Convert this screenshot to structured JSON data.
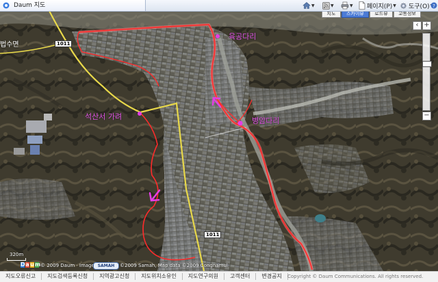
{
  "browser": {
    "tab_title": "Daum 지도",
    "page_menu": "페이지(P)",
    "tools_menu": "도구(O)",
    "icons": [
      "home-icon",
      "feeds-icon",
      "print-icon",
      "page-icon",
      "tools-icon",
      "help-icon"
    ]
  },
  "map": {
    "type_buttons": [
      {
        "label": "지도",
        "active": false
      },
      {
        "label": "스카이뷰",
        "active": true
      },
      {
        "label": "로드뷰",
        "active": false
      },
      {
        "label": "교통정보",
        "active": false
      }
    ],
    "place_labels": {
      "left_edge": "법수면",
      "route_left": "석산서 가려",
      "route_top": "육공다리",
      "route_mid": "병암다리"
    },
    "road_numbers": [
      "1011",
      "1011"
    ],
    "zoom": {
      "in": "+",
      "out": "−"
    },
    "scale": "320m",
    "logo": "Daum",
    "copyright_imagery": "© 2009 Daum · Imagery",
    "provider_logo": "SAMAH",
    "copyright_data": "©2009 Samah, Map data ©2009 Congnamul",
    "colors": {
      "route": "#ff2b2b",
      "route_outline": "#ff7a7a",
      "marker": "#e33ee6",
      "road": "#f3e14a"
    }
  },
  "footer": {
    "links": [
      "지도오류신고",
      "지도검색등록신청",
      "지역광고신청",
      "지도위치소유인",
      "지도연구의원",
      "고객센터",
      "변경공지"
    ],
    "copyright": "Copyright © Daum Communications. All rights reserved."
  }
}
